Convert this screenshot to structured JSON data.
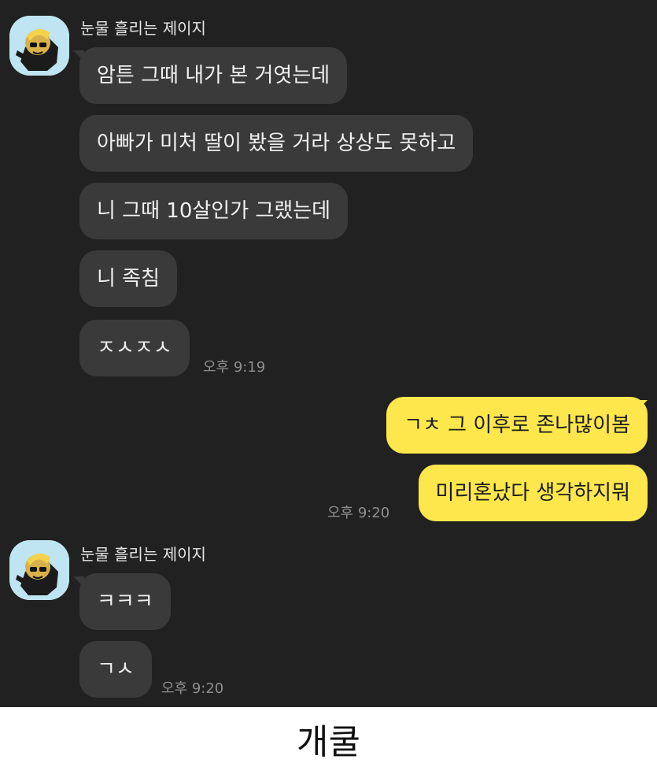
{
  "chat": {
    "group1": {
      "sender": "눈물 흘리는 제이지",
      "messages": [
        "암튼 그때 내가 본 거엿는데",
        "아빠가 미처 딸이 봤을 거라 상상도 못하고",
        "니 그때 10살인가 그랬는데",
        "니 족침",
        "ㅈㅅㅈㅅ"
      ],
      "time": "오후 9:19"
    },
    "mine": {
      "messages": [
        "ㄱㅊ 그 이후로 존나많이봄",
        "미리혼났다 생각하지뭐"
      ],
      "time": "오후 9:20"
    },
    "group2": {
      "sender": "눈물 흘리는 제이지",
      "messages": [
        "ㅋㅋㅋ",
        "ㄱㅅ"
      ],
      "time": "오후 9:20"
    }
  },
  "caption": "개쿨",
  "colors": {
    "background": "#212121",
    "incoming_bubble": "#3a3a3a",
    "outgoing_bubble": "#fde74c",
    "avatar_bg": "#bfe4f2"
  },
  "icons": {
    "avatar": "crying-character-avatar-icon"
  }
}
